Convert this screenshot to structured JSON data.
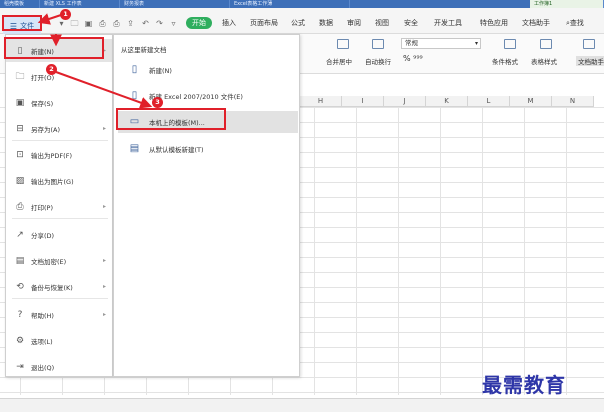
{
  "tabs": [
    {
      "label": "稻壳模板",
      "active": false
    },
    {
      "label": "新建 XLS 工作表",
      "active": false
    },
    {
      "label": "财务报表",
      "active": false
    },
    {
      "label": "Excel表格工作薄",
      "active": false
    },
    {
      "label": "工作簿1",
      "active": true
    }
  ],
  "menubar": {
    "file_label": "文件",
    "start_label": "开始",
    "items": [
      "插入",
      "页面布局",
      "公式",
      "数据",
      "审阅",
      "视图",
      "安全",
      "开发工具",
      "特色应用",
      "文档助手"
    ],
    "search_label": "查找"
  },
  "ribbon": {
    "merge_label": "合并居中",
    "wrap_label": "自动换行",
    "format_value": "常规",
    "percent_symbols": "% ⁹⁹⁹",
    "cond_format_label": "条件格式",
    "table_style_label": "表格样式",
    "doc_assist_label": "文档助手"
  },
  "columns": [
    "H",
    "I",
    "J",
    "K",
    "L",
    "M",
    "N"
  ],
  "file_menu": {
    "items": [
      {
        "icon": "new-doc-icon",
        "label": "新建(N)",
        "has_arrow": true,
        "highlight": true
      },
      {
        "icon": "folder-icon",
        "label": "打开(O)",
        "has_arrow": false
      },
      {
        "icon": "save-icon",
        "label": "保存(S)",
        "has_arrow": false
      },
      {
        "icon": "save-as-icon",
        "label": "另存为(A)",
        "has_arrow": true
      },
      {
        "icon": "pdf-icon",
        "label": "输出为PDF(F)",
        "has_arrow": false
      },
      {
        "icon": "image-icon",
        "label": "输出为图片(G)",
        "has_arrow": false
      },
      {
        "icon": "print-icon",
        "label": "打印(P)",
        "has_arrow": true
      },
      {
        "icon": "share-icon",
        "label": "分享(D)",
        "has_arrow": false
      },
      {
        "icon": "encrypt-icon",
        "label": "文档加密(E)",
        "has_arrow": true
      },
      {
        "icon": "backup-icon",
        "label": "备份与恢复(K)",
        "has_arrow": true
      },
      {
        "icon": "help-icon",
        "label": "帮助(H)",
        "has_arrow": true
      },
      {
        "icon": "options-icon",
        "label": "选项(L)",
        "has_arrow": false
      },
      {
        "icon": "exit-icon",
        "label": "退出(Q)",
        "has_arrow": false
      }
    ]
  },
  "sub_menu": {
    "title": "从这里新建文档",
    "items": [
      {
        "icon": "new-doc-icon",
        "label": "新建(N)"
      },
      {
        "icon": "new-doc-icon",
        "label": "新建 Excel 2007/2010 文件(E)"
      },
      {
        "icon": "computer-template-icon",
        "label": "本机上的模板(M)...",
        "highlight": true
      },
      {
        "icon": "template-doc-icon",
        "label": "从默认模板新建(T)"
      }
    ]
  },
  "annotations": {
    "step1": "1",
    "step2": "2",
    "step3": "3"
  },
  "watermark": "最需教育",
  "colors": {
    "red": "#e0202a",
    "start_green": "#2fae5e",
    "tab_blue": "#3d6fb8",
    "watermark": "#2e36a8"
  }
}
